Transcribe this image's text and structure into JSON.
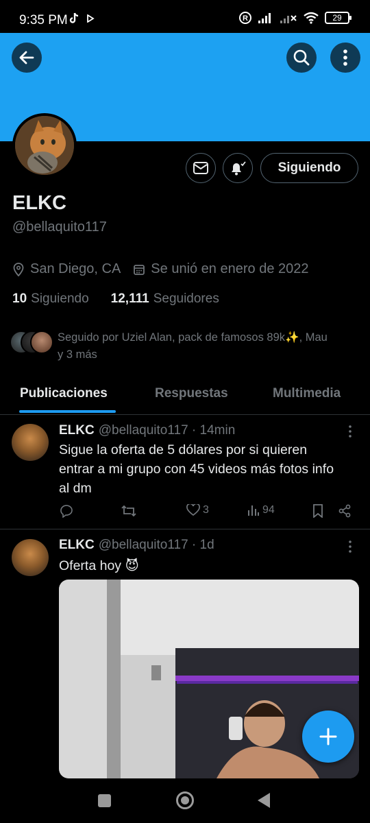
{
  "status_bar": {
    "time": "9:35 PM",
    "battery": "29"
  },
  "colors": {
    "banner": "#1da1f2",
    "accent": "#1d9bf0",
    "muted": "#71767b",
    "text": "#e7e9ea",
    "divider": "#2f3336"
  },
  "header": {
    "back_icon": "arrow-left-icon",
    "search_icon": "search-icon",
    "more_icon": "more-vertical-icon"
  },
  "profile": {
    "display_name": "ELKC",
    "handle": "@bellaquito117",
    "location": "San Diego, CA",
    "joined": "Se unió en enero de 2022",
    "following_count": "10",
    "following_label": "Siguiendo",
    "followers_count": "12,111",
    "followers_label": "Seguidores",
    "followed_by_line1": "Seguido por Uziel Alan, pack de famosos 89k✨, Mau",
    "followed_by_line2": "y 3 más",
    "follow_button_label": "Siguiendo"
  },
  "tabs": [
    {
      "label": "Publicaciones",
      "active": true
    },
    {
      "label": "Respuestas",
      "active": false
    },
    {
      "label": "Multimedia",
      "active": false
    }
  ],
  "tweets": [
    {
      "name": "ELKC",
      "handle_time": "@bellaquito117 · 14min",
      "text_line1": "Sigue la oferta  de 5 dólares por si quieren",
      "text_line2": "entrar a mi grupo con 45 videos más fotos info",
      "text_line3": "al dm",
      "likes": "3",
      "views": "94"
    },
    {
      "name": "ELKC",
      "handle_time": "@bellaquito117 · 1d",
      "text": "Oferta hoy 😈"
    }
  ]
}
